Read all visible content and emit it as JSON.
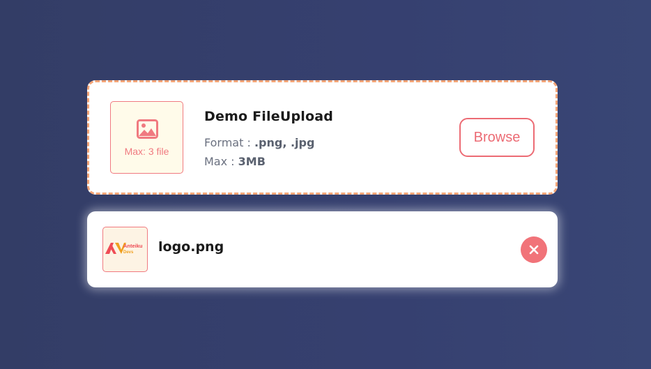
{
  "upload": {
    "title": "Demo FileUpload",
    "dropzone": {
      "icon": "image-icon",
      "max_files_label": "Max: 3 file"
    },
    "format_label": "Format : ",
    "format_value": ".png, .jpg",
    "max_label": "Max : ",
    "max_value": "3MB",
    "browse_label": "Browse"
  },
  "files": [
    {
      "name": "logo.png",
      "thumbnail_text_line1": "Anteiku",
      "thumbnail_text_line2": "Devs",
      "remove_icon": "close-icon"
    }
  ],
  "colors": {
    "background": "#364070",
    "accent": "#f07a80",
    "dashed_border": "#f2a477",
    "dropzone_fill": "#fffbea"
  }
}
